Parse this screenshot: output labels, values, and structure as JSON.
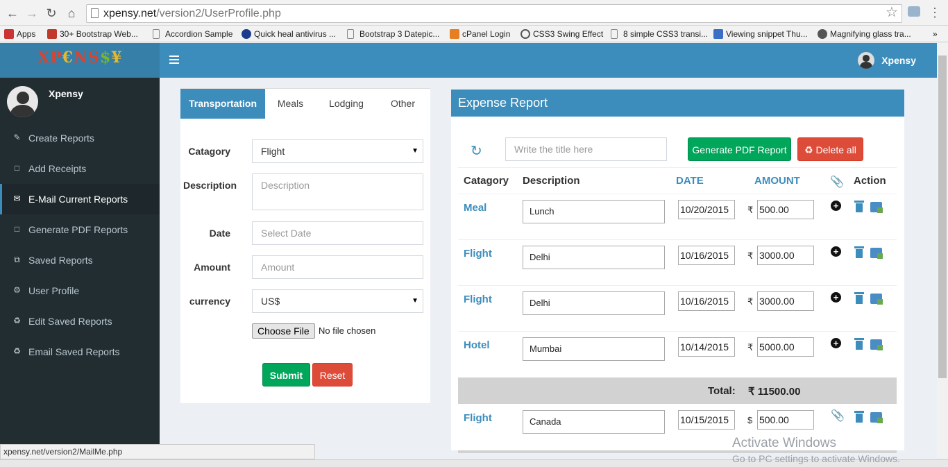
{
  "browser": {
    "url_host": "xpensy.net",
    "url_path": "/version2/UserProfile.php",
    "bookmarks": [
      "Apps",
      "30+ Bootstrap Web...",
      "Accordion Sample",
      "Quick heal antivirus ...",
      "Bootstrap 3 Datepic...",
      "cPanel Login",
      "CSS3 Swing Effect",
      "8 simple CSS3 transi...",
      "Viewing snippet Thu...",
      "Magnifying glass tra..."
    ],
    "status_url": "xpensy.net/version2/MailMe.php"
  },
  "header": {
    "logo_text": "XPENSY",
    "user_name": "Xpensy"
  },
  "sidebar": {
    "user_name": "Xpensy",
    "items": [
      {
        "label": "Create Reports",
        "icon": "edit-icon"
      },
      {
        "label": "Add Receipts",
        "icon": "file-icon"
      },
      {
        "label": "E-Mail Current Reports",
        "icon": "envelope-icon"
      },
      {
        "label": "Generate PDF Reports",
        "icon": "file-icon"
      },
      {
        "label": "Saved Reports",
        "icon": "copy-icon"
      },
      {
        "label": "User Profile",
        "icon": "gears-icon"
      },
      {
        "label": "Edit Saved Reports",
        "icon": "trash-icon"
      },
      {
        "label": "Email Saved Reports",
        "icon": "trash-icon"
      }
    ],
    "active_index": 2
  },
  "form": {
    "tabs": [
      "Transportation",
      "Meals",
      "Lodging",
      "Other"
    ],
    "active_tab": 0,
    "category_label": "Catagory",
    "category_value": "Flight",
    "description_label": "Description",
    "description_placeholder": "Description",
    "date_label": "Date",
    "date_placeholder": "Select Date",
    "amount_label": "Amount",
    "amount_placeholder": "Amount",
    "currency_label": "currency",
    "currency_value": "US$",
    "file_button": "Choose File",
    "file_status": "No file chosen",
    "submit_label": "Submit",
    "reset_label": "Reset"
  },
  "report": {
    "title": "Expense Report",
    "title_placeholder": "Write the title here",
    "pdf_button": "Generate PDF Report",
    "delete_button": "Delete all",
    "columns": {
      "category": "Catagory",
      "description": "Description",
      "date": "DATE",
      "amount": "AMOUNT",
      "action": "Action"
    },
    "rows": [
      {
        "category": "Meal",
        "description": "Lunch",
        "date": "10/20/2015",
        "currency": "₹",
        "amount": "500.00"
      },
      {
        "category": "Flight",
        "description": "Delhi",
        "date": "10/16/2015",
        "currency": "₹",
        "amount": "3000.00"
      },
      {
        "category": "Flight",
        "description": "Delhi",
        "date": "10/16/2015",
        "currency": "₹",
        "amount": "3000.00"
      },
      {
        "category": "Hotel",
        "description": "Mumbai",
        "date": "10/14/2015",
        "currency": "₹",
        "amount": "5000.00"
      }
    ],
    "total_label": "Total:",
    "total_value": "₹ 11500.00",
    "extra_row": {
      "category": "Flight",
      "description": "Canada",
      "date": "10/15/2015",
      "currency": "$",
      "amount": "500.00"
    }
  },
  "watermark": {
    "line1": "Activate Windows",
    "line2": "Go to PC settings to activate Windows."
  },
  "colors": {
    "primary": "#3c8dbc",
    "sidebar": "#222d32",
    "success": "#00a65a",
    "danger": "#dd4b39"
  }
}
